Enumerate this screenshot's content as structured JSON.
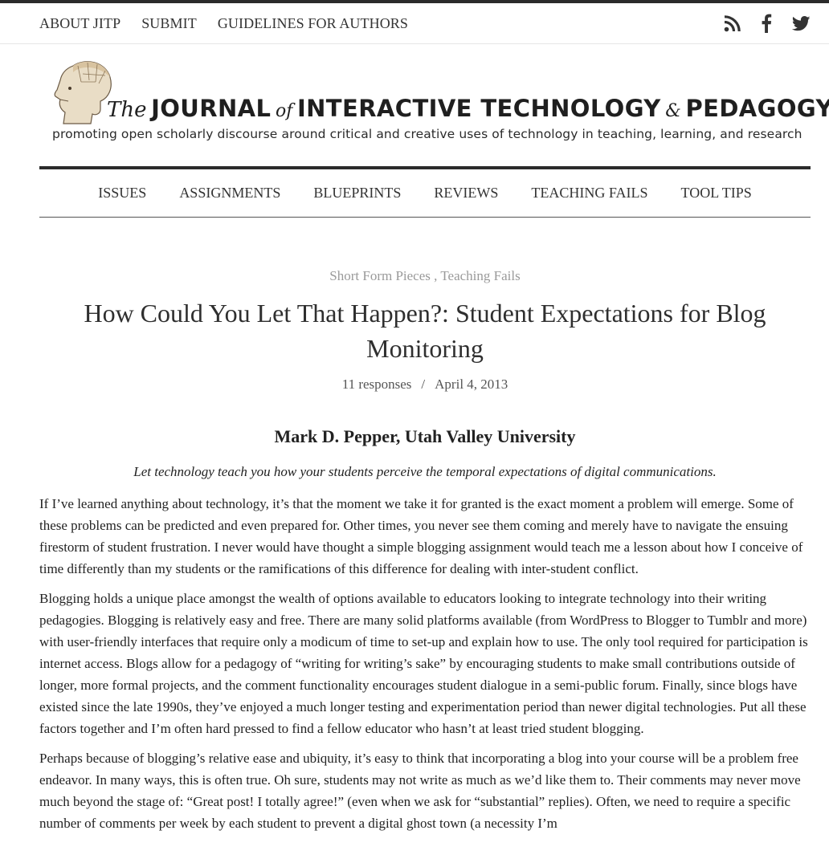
{
  "top_nav": {
    "links": [
      "ABOUT JITP",
      "SUBMIT",
      "GUIDELINES FOR AUTHORS"
    ],
    "social_icons": [
      "rss-icon",
      "facebook-icon",
      "twitter-icon"
    ]
  },
  "masthead": {
    "title_the": "The",
    "title_journal": "JOURNAL",
    "title_of": "of",
    "title_interactive": "INTERACTIVE TECHNOLOGY",
    "title_amp": "&",
    "title_pedagogy": "PEDAGOGY",
    "tagline": "promoting open scholarly discourse around critical and creative uses of technology in teaching, learning, and research"
  },
  "main_nav": {
    "items": [
      "ISSUES",
      "ASSIGNMENTS",
      "BLUEPRINTS",
      "REVIEWS",
      "TEACHING FAILS",
      "TOOL TIPS"
    ]
  },
  "article": {
    "categories": [
      "Short Form Pieces",
      "Teaching Fails"
    ],
    "category_separator": " , ",
    "title": "How Could You Let That Happen?: Student Expectations for Blog Monitoring",
    "responses": "11 responses",
    "meta_separator": "/",
    "date": "April 4, 2013",
    "author": "Mark D. Pepper, Utah Valley University",
    "lede": "Let technology teach you how your students perceive the temporal expectations of digital communications.",
    "paragraphs": [
      "If I’ve learned anything about technology, it’s that the moment we take it for granted is the exact moment a problem will emerge. Some of these problems can be predicted and even prepared for. Other times, you never see them coming and merely have to navigate the ensuing firestorm of student frustration. I never would have thought a simple blogging assignment would teach me a lesson about how I conceive of time differently than my students or the ramifications of this difference for dealing with inter-student conflict.",
      "Blogging holds a unique place amongst the wealth of options available to educators looking to integrate technology into their writing pedagogies. Blogging is relatively easy and free. There are many solid platforms available (from WordPress to Blogger to Tumblr and more) with user-friendly interfaces that require only a modicum of time to set-up and explain how to use. The only tool required for participation is internet access.  Blogs allow for a pedagogy of “writing for writing’s sake” by encouraging students to make small contributions outside of longer, more formal projects, and the comment functionality encourages student dialogue in a semi-public forum. Finally, since blogs have existed since the late 1990s, they’ve enjoyed a much longer testing and experimentation period than newer digital technologies. Put all these factors together and I’m often hard pressed to find a fellow educator who hasn’t at least tried student blogging.",
      "Perhaps because of blogging’s relative ease and ubiquity, it’s easy to think that incorporating a blog into your course will be a problem free endeavor. In many ways, this is often true. Oh sure, students may not write as much as we’d like them to. Their comments may never move much beyond the stage of: “Great post! I totally agree!” (even when we ask for  “substantial” replies). Often, we need to require a specific number of comments per week by each student to prevent a digital ghost town (a necessity I’m"
    ]
  }
}
